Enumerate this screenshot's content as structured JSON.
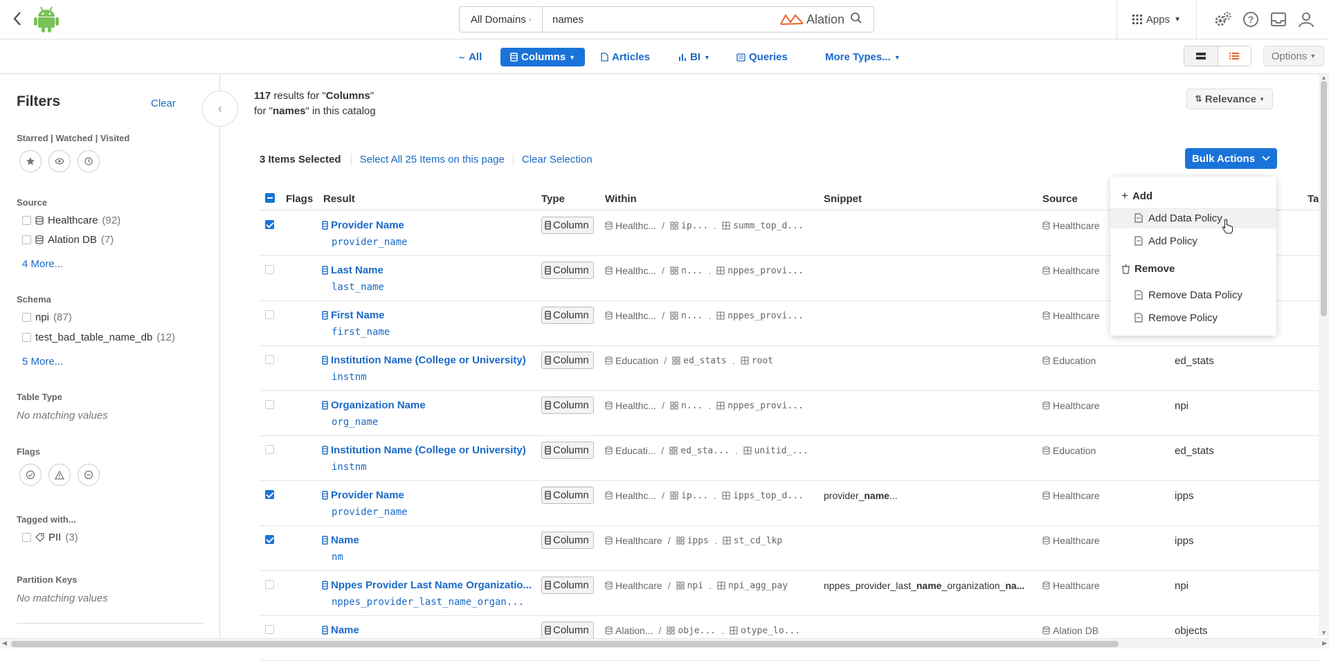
{
  "topbar": {
    "domain_select": "All Domains",
    "search_value": "names",
    "search_placeholder": "Search",
    "brand": "Alation",
    "apps_label": "Apps"
  },
  "tabs": [
    {
      "label": "All",
      "icon": "sparkline-icon"
    },
    {
      "label": "Columns",
      "icon": "column-icon",
      "active": true
    },
    {
      "label": "Articles",
      "icon": "article-icon"
    },
    {
      "label": "BI",
      "icon": "bar-chart-icon"
    },
    {
      "label": "Queries",
      "icon": "query-icon"
    },
    {
      "label": "More Types...",
      "icon": "chevron-down-icon"
    }
  ],
  "options_label": "Options",
  "sidebar": {
    "title": "Filters",
    "clear": "Clear",
    "starred_title": "Starred | Watched | Visited",
    "source_title": "Source",
    "source_items": [
      {
        "label": "Healthcare",
        "count": "(92)"
      },
      {
        "label": "Alation DB",
        "count": "(7)"
      }
    ],
    "source_more": "4 More...",
    "schema_title": "Schema",
    "schema_items": [
      {
        "label": "npi",
        "count": "(87)"
      },
      {
        "label": "test_bad_table_name_db",
        "count": "(12)"
      }
    ],
    "schema_more": "5 More...",
    "table_type_title": "Table Type",
    "table_type_empty": "No matching values",
    "flags_title": "Flags",
    "tagged_title": "Tagged with...",
    "tagged_items": [
      {
        "label": "PII",
        "count": "(3)"
      }
    ],
    "partition_title": "Partition Keys",
    "partition_empty": "No matching values"
  },
  "results": {
    "count": "117",
    "results_for": " results for \"",
    "type": "Columns",
    "for_label": " for \"",
    "query": "names",
    "scope": "\" in this catalog",
    "sort_label": "Relevance"
  },
  "selection": {
    "count": "3 Items Selected",
    "select_all": "Select All 25 Items on this page",
    "clear": "Clear Selection",
    "bulk_actions": "Bulk Actions"
  },
  "table": {
    "headers": [
      "Flags",
      "Result",
      "Type",
      "Within",
      "Snippet",
      "Source",
      "Ta"
    ],
    "rows": [
      {
        "title": "Provider Name",
        "sub": "provider_name",
        "type": "Column",
        "ds": "Healthc...",
        "schema": "ip...",
        "table": "summ_top_d...",
        "snippet": "",
        "source": "Healthcare",
        "schema_col": "",
        "checked": true
      },
      {
        "title": "Last Name",
        "sub": "last_name",
        "type": "Column",
        "ds": "Healthc...",
        "schema": "n...",
        "table": "nppes_provi...",
        "snippet": "",
        "source": "Healthcare",
        "schema_col": "",
        "checked": false
      },
      {
        "title": "First Name",
        "sub": "first_name",
        "type": "Column",
        "ds": "Healthc...",
        "schema": "n...",
        "table": "nppes_provi...",
        "snippet": "",
        "source": "Healthcare",
        "schema_col": "",
        "checked": false
      },
      {
        "title": "Institution Name (College or University)",
        "sub": "instnm",
        "type": "Column",
        "ds": "Education",
        "schema": "ed_stats",
        "table": "root",
        "snippet": "",
        "source": "Education",
        "schema_col": "ed_stats",
        "checked": false
      },
      {
        "title": "Organization Name",
        "sub": "org_name",
        "type": "Column",
        "ds": "Healthc...",
        "schema": "n...",
        "table": "nppes_provi...",
        "snippet": "",
        "source": "Healthcare",
        "schema_col": "npi",
        "checked": false
      },
      {
        "title": "Institution Name (College or University)",
        "sub": "instnm",
        "type": "Column",
        "ds": "Educati...",
        "schema": "ed_sta...",
        "table": "unitid_...",
        "snippet": "",
        "source": "Education",
        "schema_col": "ed_stats",
        "checked": false
      },
      {
        "title": "Provider Name",
        "sub": "provider_name",
        "type": "Column",
        "ds": "Healthc...",
        "schema": "ip...",
        "table": "ipps_top_d...",
        "snippet_pre": "provider_",
        "snippet_bold": "name",
        "snippet_post": "...",
        "source": "Healthcare",
        "schema_col": "ipps",
        "checked": true
      },
      {
        "title": "Name",
        "sub": "nm",
        "type": "Column",
        "ds": "Healthcare",
        "schema": "ipps",
        "table": "st_cd_lkp",
        "snippet": "",
        "source": "Healthcare",
        "schema_col": "ipps",
        "checked": true
      },
      {
        "title": "Nppes Provider Last Name Organizatio...",
        "sub": "nppes_provider_last_name_organ...",
        "type": "Column",
        "ds": "Healthcare",
        "schema": "npi",
        "table": "npi_agg_pay",
        "snippet_pre": "nppes_provider_last_",
        "snippet_bold": "name",
        "snippet_post": "_organization_",
        "snippet_bold2": "na...",
        "source": "Healthcare",
        "schema_col": "npi",
        "checked": false
      },
      {
        "title": "Name",
        "sub": "",
        "type": "Column",
        "ds": "Alation...",
        "schema": "obje...",
        "table": "otype_lo...",
        "snippet": "",
        "source": "Alation DB",
        "schema_col": "objects",
        "checked": false
      }
    ]
  },
  "dropdown": {
    "add_head": "Add",
    "add_items": [
      "Add Data Policy",
      "Add Policy"
    ],
    "remove_head": "Remove",
    "remove_items": [
      "Remove Data Policy",
      "Remove Policy"
    ]
  },
  "colors": {
    "accent": "#1a73d9",
    "link": "#1a6ac7",
    "android": "#78c257",
    "alation": "#e8642c"
  }
}
